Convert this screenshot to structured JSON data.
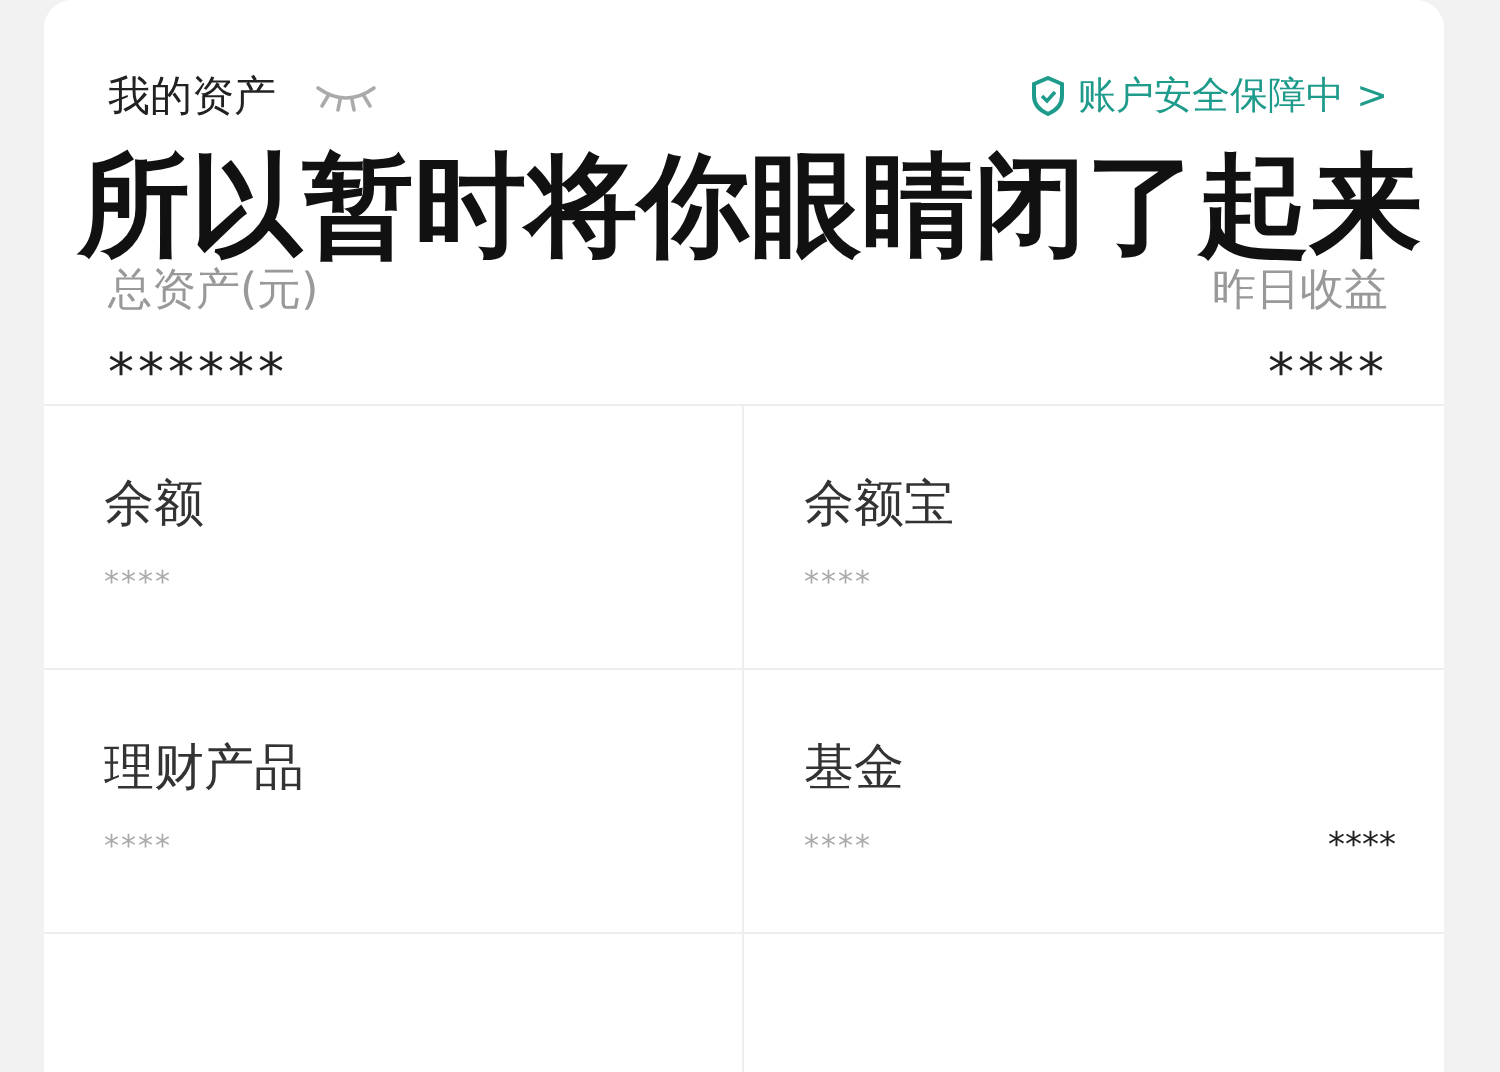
{
  "header": {
    "title": "我的资产",
    "security": "账户安全保障中",
    "chevron": ">"
  },
  "caption": "所以暂时将你眼睛闭了起来",
  "summary": {
    "total_label": "总资产(元)",
    "total_value": "******",
    "yesterday_label": "昨日收益",
    "yesterday_value": "****"
  },
  "cells": [
    {
      "title": "余额",
      "value": "****"
    },
    {
      "title": "余额宝",
      "value": "****"
    },
    {
      "title": "理财产品",
      "value": "****"
    },
    {
      "title": "基金",
      "value": "****",
      "extra": "****"
    }
  ]
}
